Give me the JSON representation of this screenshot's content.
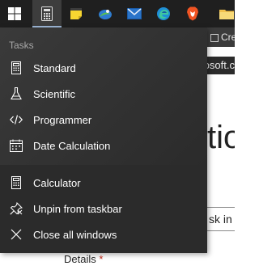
{
  "taskbar": {
    "icons": [
      "windows-start-icon",
      "calculator-icon",
      "sticky-notes-icon",
      "photos-icon",
      "mail-icon",
      "edge-icon",
      "brave-icon",
      "file-explorer-icon"
    ]
  },
  "background": {
    "tab_label": "Cre",
    "url_fragment": "osoft.c",
    "heading_fragment": "tio",
    "input_fragment": "sk in",
    "details_label": "Details",
    "required_marker": "*"
  },
  "jumplist": {
    "tasks_header": "Tasks",
    "tasks": [
      {
        "label": "Standard",
        "icon": "standard-calculator-icon"
      },
      {
        "label": "Scientific",
        "icon": "flask-icon"
      },
      {
        "label": "Programmer",
        "icon": "code-icon"
      },
      {
        "label": "Date Calculation",
        "icon": "calendar-icon"
      }
    ],
    "actions": [
      {
        "label": "Calculator",
        "icon": "calculator-icon"
      },
      {
        "label": "Unpin from taskbar",
        "icon": "unpin-icon"
      },
      {
        "label": "Close all windows",
        "icon": "close-icon"
      }
    ]
  },
  "colors": {
    "taskbar_bg": "#1f1f1f",
    "jumplist_bg": "#2b2b2b",
    "active_tab_bg": "#3d3d3d"
  }
}
